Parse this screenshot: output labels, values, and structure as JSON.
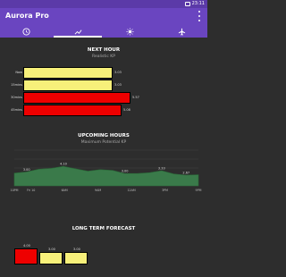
{
  "status": {
    "time": "23:11"
  },
  "header": {
    "title": "Aurora Pro"
  },
  "tabs": [
    {
      "name": "tab-clock",
      "icon": "clock-icon",
      "active": false
    },
    {
      "name": "tab-graph",
      "icon": "trend-icon",
      "active": true
    },
    {
      "name": "tab-sun",
      "icon": "sun-icon",
      "active": false
    },
    {
      "name": "tab-plane",
      "icon": "airplane-icon",
      "active": false
    }
  ],
  "next_hour": {
    "title": "NEXT HOUR",
    "subtitle": "Realistic KP",
    "rows": [
      {
        "label": "Now",
        "value": 0.83,
        "value_text": "3.03",
        "color": "#f7f07a"
      },
      {
        "label": "15mins",
        "value": 0.83,
        "value_text": "3.03",
        "color": "#f7f07a"
      },
      {
        "label": "30mins",
        "value": 1.0,
        "value_text": "5.57",
        "color": "#ee0000"
      },
      {
        "label": "45mins",
        "value": 0.92,
        "value_text": "5.08",
        "color": "#ee0000"
      }
    ]
  },
  "upcoming": {
    "title": "UPCOMING HOURS",
    "subtitle": "Maximum Potential KP"
  },
  "long_term": {
    "title": "LONG TERM FORECAST",
    "bars": [
      {
        "value_text": "4.00",
        "value": 4.0,
        "color": "#ee0000"
      },
      {
        "value_text": "3.00",
        "value": 3.0,
        "color": "#f7f07a"
      },
      {
        "value_text": "3.00",
        "value": 3.0,
        "color": "#f7f07a"
      }
    ]
  },
  "chart_data": {
    "type": "area",
    "x": [
      "10PM",
      "Fri 10",
      "6AM",
      "9AM",
      "12PM",
      "3PM",
      "9PM"
    ],
    "x_ticks": [
      "10PM",
      "Fri 10",
      "",
      "6AM",
      "",
      "9AM",
      "",
      "12AM",
      "",
      "3PM",
      "",
      "9PM"
    ],
    "values": [
      3.2,
      3.5,
      4.2,
      4.4,
      4.9,
      4.3,
      3.7,
      4.1,
      3.9,
      3.1,
      3.1,
      3.3,
      3.8,
      3.0,
      2.7,
      2.8
    ],
    "labels": [
      {
        "index": 1,
        "text": "3.00"
      },
      {
        "index": 4,
        "text": "4.10"
      },
      {
        "index": 9,
        "text": "3.00"
      },
      {
        "index": 12,
        "text": "3.33"
      },
      {
        "index": 14,
        "text": "2.67"
      }
    ],
    "fill": "#3a7a4a",
    "line": "#2a6a38",
    "ylim": [
      0,
      9
    ],
    "grid": true
  }
}
